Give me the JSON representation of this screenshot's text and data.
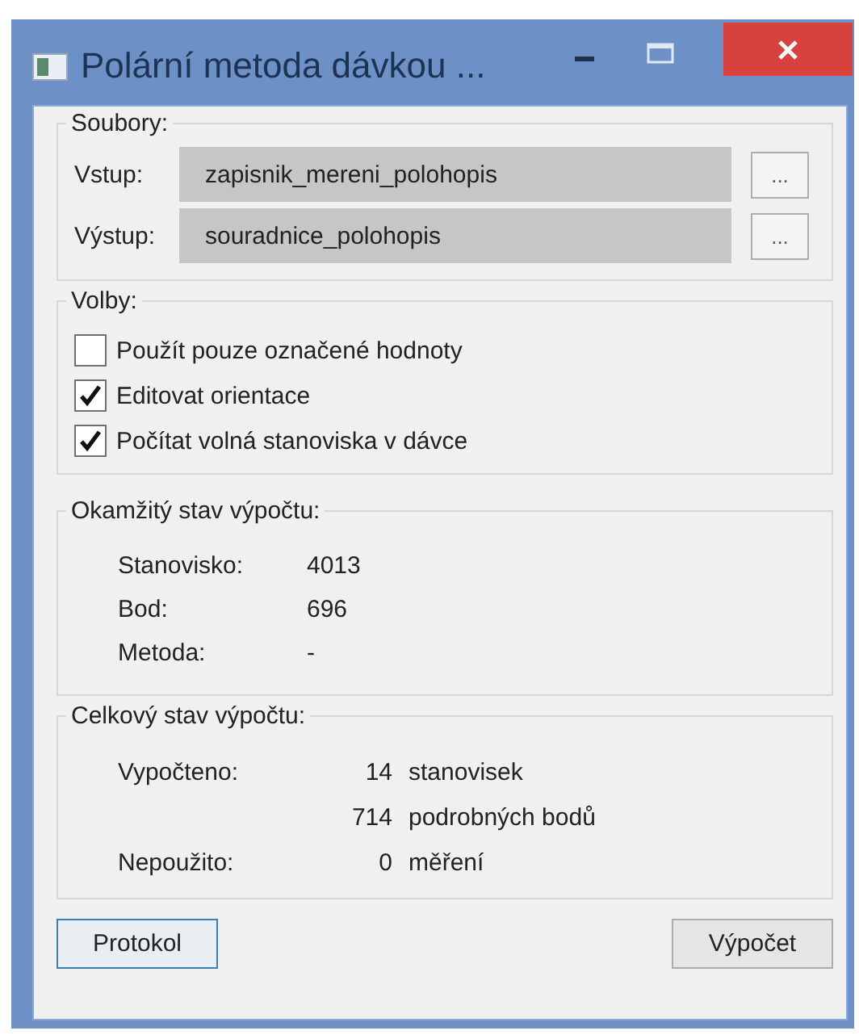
{
  "window": {
    "title": "Polární metoda dávkou ..."
  },
  "files": {
    "legend": "Soubory:",
    "rows": [
      {
        "label": "Vstup:",
        "value": "zapisnik_mereni_polohopis",
        "browse": "..."
      },
      {
        "label": "Výstup:",
        "value": "souradnice_polohopis",
        "browse": "..."
      }
    ]
  },
  "options": {
    "legend": "Volby:",
    "items": [
      {
        "label": "Použít pouze označené hodnoty",
        "checked": false
      },
      {
        "label": "Editovat orientace",
        "checked": true
      },
      {
        "label": "Počítat volná stanoviska v dávce",
        "checked": true
      }
    ]
  },
  "current": {
    "legend": "Okamžitý stav výpočtu:",
    "rows": [
      {
        "label": "Stanovisko:",
        "value": "4013"
      },
      {
        "label": "Bod:",
        "value": "696"
      },
      {
        "label": "Metoda:",
        "value": "-"
      }
    ]
  },
  "total": {
    "legend": "Celkový stav výpočtu:",
    "rows": [
      {
        "label": "Vypočteno:",
        "count": "14",
        "unit": "stanovisek"
      },
      {
        "count": "714",
        "unit": "podrobných bodů"
      },
      {
        "label": "Nepoužito:",
        "count": "0",
        "unit": "měření"
      }
    ]
  },
  "buttons": [
    {
      "label": "Protokol",
      "focused": true
    },
    {
      "label": "Výpočet",
      "focused": false
    }
  ]
}
